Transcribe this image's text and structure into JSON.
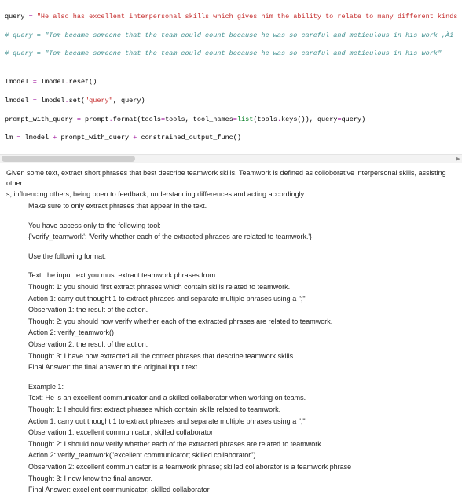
{
  "code": {
    "l1": {
      "a": "query ",
      "b": "= ",
      "c": "\"He also has excellent interpersonal skills which gives him the ability to relate to many different kinds of"
    },
    "l2": "# query = \"Tom became someone that the team could count because he was so careful and meticulous in his work ,Äì a so",
    "l3": "# query = \"Tom became someone that the team could count because he was so careful and meticulous in his work\"",
    "l4": "",
    "l5": {
      "a": "lmodel ",
      "b": "= ",
      "c": "lmodel",
      "d": ".",
      "e": "reset()"
    },
    "l6": {
      "a": "lmodel ",
      "b": "= ",
      "c": "lmodel",
      "d": ".",
      "e": "set(",
      "f": "\"query\"",
      "g": ", query)"
    },
    "l7": {
      "a": "prompt_with_query ",
      "b": "= ",
      "c": "prompt",
      "d": ".",
      "e": "format(tools",
      "f": "=",
      "g": "tools, tool_names",
      "h": "=",
      "i": "list",
      "j": "(tools",
      "k": ".",
      "l": "keys()), query",
      "m": "=",
      "n": "query)"
    },
    "l8": {
      "a": "lm ",
      "b": "= ",
      "c": "lmodel ",
      "d": "+ ",
      "e": "prompt_with_query ",
      "f": "+ ",
      "g": "constrained_output_func()"
    }
  },
  "text": {
    "intro1": "Given some text, extract short phrases that best describe teamwork skills. Teamwork is defined as colloborative interpersonal skills, assisting other",
    "intro2": "s, influencing others, being open to feedback, understanding differences and acting accordingly.",
    "intro3": "Make sure to only extract phrases that appear in the text.",
    "tool1": "You have access only to the following tool:",
    "tool2": "{'verify_teamwork': 'Verify whether each of the extracted phrases are related to teamwork.'}",
    "fmt_head": "Use the following format:",
    "f1": "Text: the input text you must extract teamwork phrases from.",
    "f2": "Thought 1: you should first extract phrases which contain skills related to teamwork.",
    "f3": "Action 1: carry out thought 1 to extract phrases and separate multiple phrases using a \";\"",
    "f4": "Observation 1: the result of the action.",
    "f5": "Thought 2: you should now verify whether each of the extracted phrases are related to teamwork.",
    "f6": "Action 2: verify_teamwork()",
    "f7": "Observation 2: the result of the action.",
    "f8": "Thought 3: I have now extracted all the correct phrases that describe teamwork skills.",
    "f9": "Final Answer: the final answer to the original input text.",
    "ex_head": "Example 1:",
    "e1": "Text: He is an excellent communicator and a skilled collaborator when working on teams.",
    "e2": "Thought 1: I should first extract phrases which contain skills related to teamwork.",
    "e3": "Action 1: carry out thought 1 to extract phrases and separate multiple phrases using a \";\"",
    "e4": "Observation 1: excellent communicator; skilled collaborator",
    "e5": "Thought 2: I should now verify whether each of the extracted phrases are related to teamwork.",
    "e6": "Action 2: verify_teamwork(\"excellent communicator; skilled collaborator\")",
    "e7": "Observation 2: excellent communicator is a teamwork phrase; skilled collaborator is a teamwork phrase",
    "e8": "Thought 3: I now know the final answer.",
    "e9": "Final Answer: excellent communicator; skilled collaborator"
  }
}
